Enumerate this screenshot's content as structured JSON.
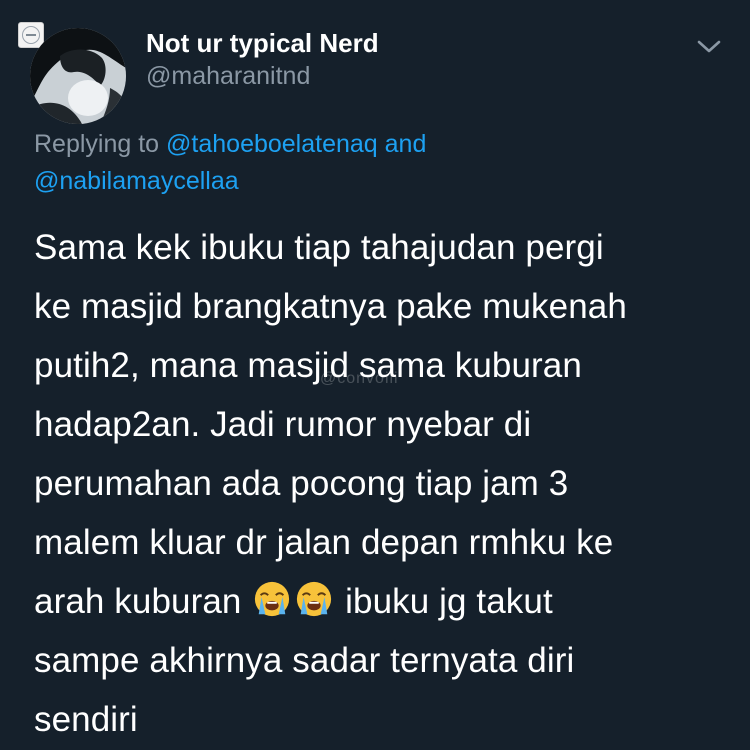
{
  "author": {
    "display_name": "Not ur typical Nerd",
    "handle": "@maharanitnd"
  },
  "reply": {
    "prefix": "Replying to",
    "mention_1": "@tahoeboelatenaq",
    "conjunction": "and",
    "mention_2": "@nabilamaycellaa"
  },
  "tweet": {
    "lines": [
      "Sama kek ibuku tiap tahajudan pergi",
      "ke masjid brangkatnya pake mukenah",
      "putih2, mana masjid sama kuburan",
      "hadap2an. Jadi rumor nyebar di",
      "perumahan ada pocong tiap jam 3",
      "malem kluar dr jalan depan rmhku ke",
      "arah kuburan",
      "ibuku jg takut",
      "sampe akhirnya sadar ternyata diri",
      "sendiri"
    ]
  },
  "watermark_text": "@convoiii",
  "icons": {
    "badge": "watermark-badge-icon",
    "chevron": "chevron-down-icon",
    "emoji": "loudly-crying-face-emoji"
  },
  "colors": {
    "background": "#15202b",
    "text": "#ffffff",
    "muted": "#8b98a5",
    "link": "#1da1f2"
  }
}
